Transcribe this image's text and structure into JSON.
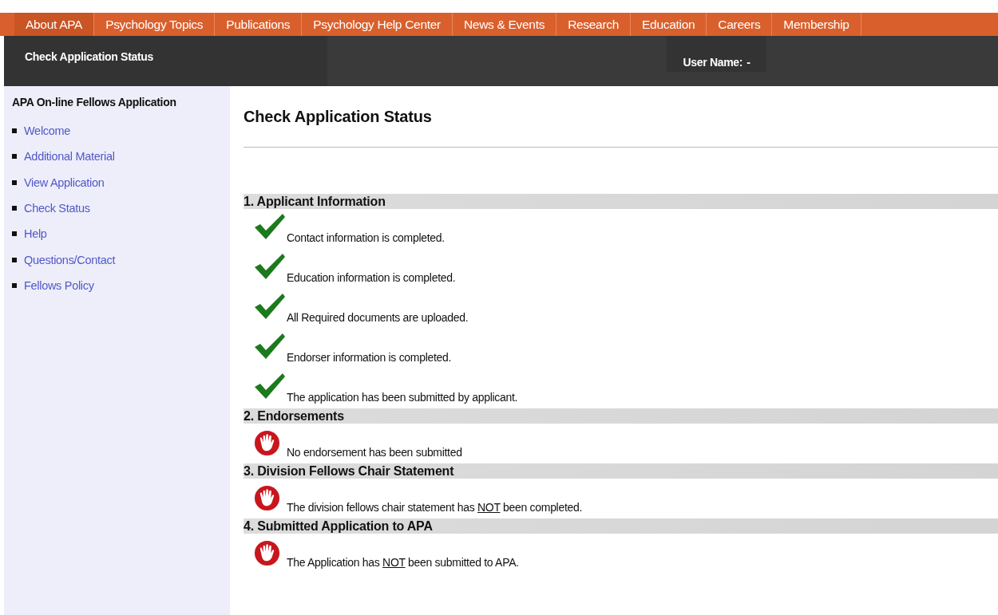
{
  "nav": [
    {
      "label": "About APA",
      "selected": true
    },
    {
      "label": "Psychology Topics",
      "selected": false
    },
    {
      "label": "Publications",
      "selected": false
    },
    {
      "label": "Psychology Help Center",
      "selected": false
    },
    {
      "label": "News & Events",
      "selected": false
    },
    {
      "label": "Research",
      "selected": false
    },
    {
      "label": "Education",
      "selected": false
    },
    {
      "label": "Careers",
      "selected": false
    },
    {
      "label": "Membership",
      "selected": false
    }
  ],
  "subheader": {
    "title": "Check Application Status",
    "user_label": "User Name:",
    "user_value": "-"
  },
  "sidebar": {
    "title": "APA On-line Fellows Application",
    "items": [
      "Welcome",
      "Additional Material",
      "View Application",
      "Check Status",
      "Help",
      "Questions/Contact",
      "Fellows Policy"
    ]
  },
  "page_title": "Check Application Status",
  "sections": [
    {
      "heading": "1. Applicant Information",
      "items": [
        {
          "kind": "check",
          "parts": [
            {
              "text": "Contact information is completed.",
              "underline": false
            }
          ]
        },
        {
          "kind": "check",
          "parts": [
            {
              "text": "Education information is completed.",
              "underline": false
            }
          ]
        },
        {
          "kind": "check",
          "parts": [
            {
              "text": "All Required documents are uploaded.",
              "underline": false
            }
          ]
        },
        {
          "kind": "check",
          "parts": [
            {
              "text": "Endorser information is completed.",
              "underline": false
            }
          ]
        },
        {
          "kind": "check",
          "parts": [
            {
              "text": "The application has been submitted by applicant.",
              "underline": false
            }
          ]
        }
      ]
    },
    {
      "heading": "2. Endorsements",
      "items": [
        {
          "kind": "stop",
          "parts": [
            {
              "text": "No endorsement has been submitted",
              "underline": false
            }
          ]
        }
      ]
    },
    {
      "heading": "3. Division Fellows Chair Statement",
      "items": [
        {
          "kind": "stop",
          "parts": [
            {
              "text": "The division fellows chair statement has ",
              "underline": false
            },
            {
              "text": "NOT",
              "underline": true
            },
            {
              "text": " been completed.",
              "underline": false
            }
          ]
        }
      ]
    },
    {
      "heading": "4. Submitted Application to APA",
      "items": [
        {
          "kind": "stop",
          "parts": [
            {
              "text": "The Application has ",
              "underline": false
            },
            {
              "text": "NOT",
              "underline": true
            },
            {
              "text": " been submitted to APA.",
              "underline": false
            }
          ]
        }
      ]
    }
  ]
}
